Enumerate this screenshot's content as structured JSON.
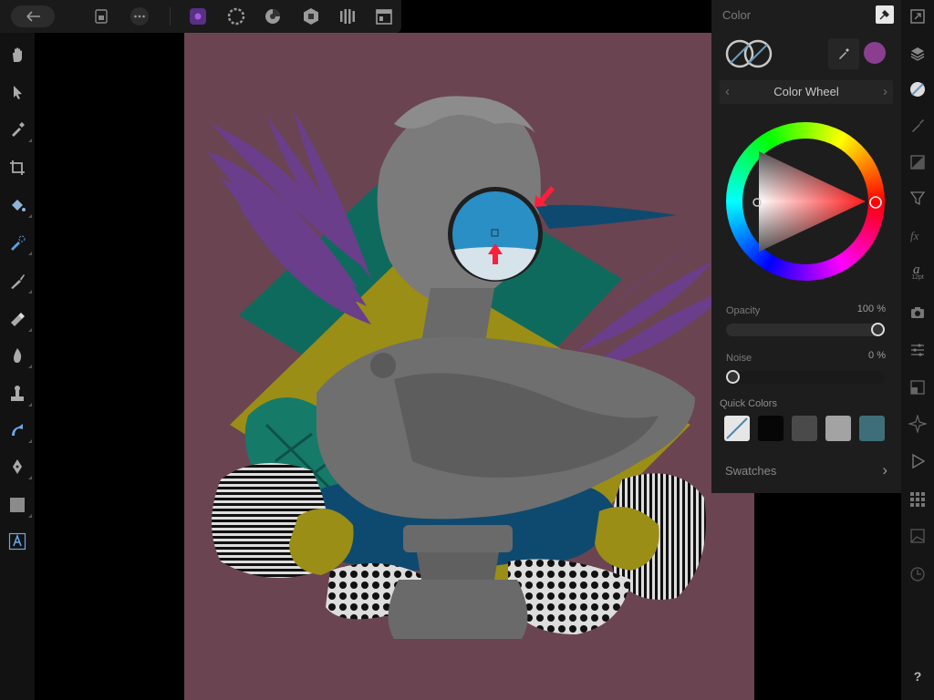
{
  "panel": {
    "title": "Color",
    "wheel_title": "Color Wheel",
    "nav_prev": "‹",
    "nav_next": "›",
    "opacity_label": "Opacity",
    "opacity_value": "100 %",
    "opacity_level": 1.0,
    "noise_label": "Noise",
    "noise_value": "0 %",
    "noise_level": 0.0,
    "quick_colors_label": "Quick Colors",
    "quick_colors": [
      "none",
      "#060606",
      "#4a4a4a",
      "#a3a3a3",
      "#3e6f78"
    ],
    "swatches_label": "Swatches",
    "swatches_chevron": "›",
    "selected_color": "#8a3f8e"
  },
  "toolbar": {
    "back_icon": "back-arrow-icon",
    "items": [
      "document-icon",
      "more-icon",
      "pixel-persona-icon",
      "liquify-persona-icon",
      "develop-persona-icon",
      "export-persona-icon",
      "adjust-icon",
      "layout-icon"
    ]
  },
  "tools": [
    "hand-icon",
    "move-icon",
    "eyedropper-icon",
    "crop-icon",
    "flood-fill-icon",
    "selection-brush-icon",
    "paint-brush-icon",
    "erase-brush-icon",
    "burn-icon",
    "clone-icon",
    "healing-icon",
    "pen-icon",
    "shape-icon",
    "text-icon"
  ],
  "studio": {
    "items": [
      "navigator-icon",
      "layers-icon",
      "color-icon",
      "brushes-icon",
      "adjustments-icon",
      "filter-icon",
      "fx-icon",
      "character-icon",
      "stock-icon",
      "channels-icon",
      "transform-icon",
      "history-icon",
      "macro-icon",
      "library-icon",
      "snapshots-icon",
      "time-icon"
    ],
    "character_caption": "12pt",
    "help_label": "?"
  },
  "canvas": {
    "background": "#6b4451",
    "loupe_color": "#2a8fc4"
  }
}
